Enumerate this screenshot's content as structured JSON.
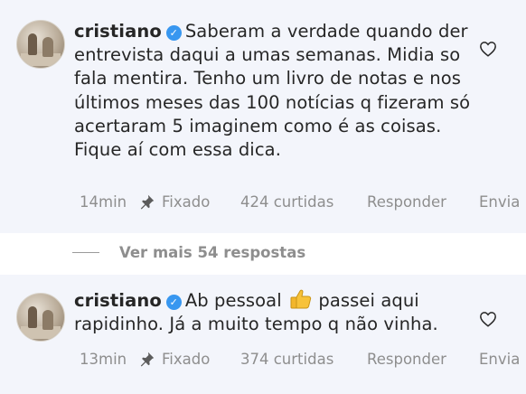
{
  "comments": [
    {
      "username": "cristiano",
      "text": "Saberam a verdade quando der entrevista daqui a umas semanas. Midia so fala mentira. Tenho um livro de notas e nos últimos meses das  100 notícias q fizeram só acertaram 5 imaginem como é as coisas. Fique aí com essa dica.",
      "time": "14min",
      "pinned_label": "Fixado",
      "likes": "424 curtidas",
      "reply_label": "Responder",
      "send_label": "Envia"
    },
    {
      "username": "cristiano",
      "text_before_emoji": "Ab pessoal",
      "text_after_emoji": "passei aqui rapidinho. Já a muito tempo q não vinha.",
      "time": "13min",
      "pinned_label": "Fixado",
      "likes": "374 curtidas",
      "reply_label": "Responder",
      "send_label": "Envia"
    }
  ],
  "more_replies": "Ver mais 54 respostas",
  "icons": {
    "verified": "verified-badge-icon",
    "like": "heart-icon",
    "pin": "pin-icon",
    "emoji": "thumbs-up-emoji"
  },
  "colors": {
    "verified": "#3897f0",
    "secondary_text": "#8e8e8e",
    "highlight_bg": "#f3f5fb"
  }
}
